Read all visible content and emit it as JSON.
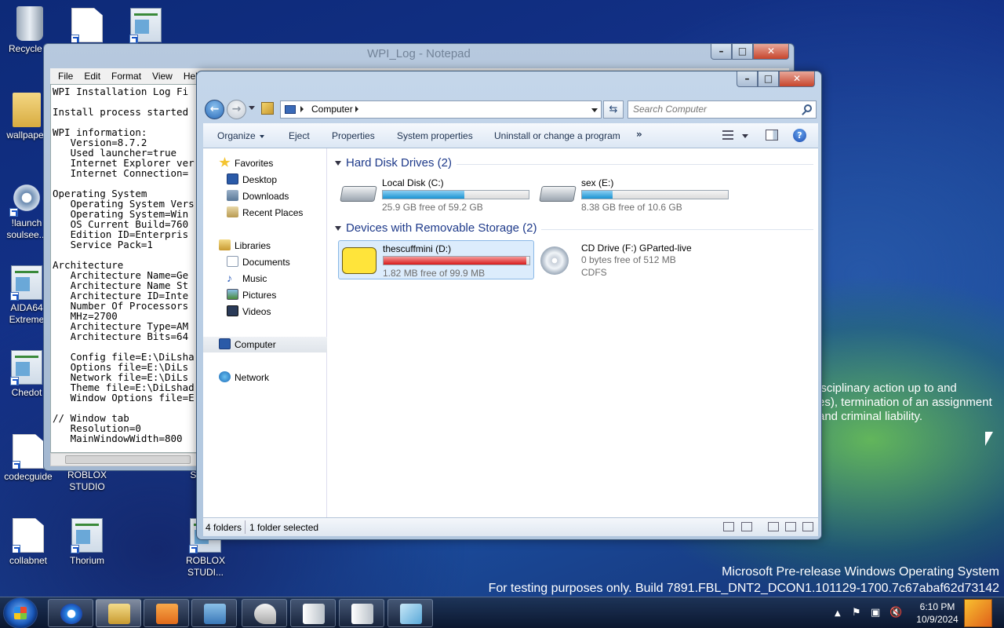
{
  "desktop": {
    "icons": [
      {
        "label": "Recycle Bin",
        "shown": "Recycle B"
      },
      {
        "label": "wallpaper",
        "shown": "wallpaper"
      },
      {
        "label": "!launch soulsee...",
        "line1": "!launch",
        "line2": "soulsee..."
      },
      {
        "label": "AIDA64 Extreme",
        "line1": "AIDA64",
        "line2": "Extreme"
      },
      {
        "label": "Chedot",
        "shown": "Chedot"
      },
      {
        "label": "codecguide",
        "shown": "codecguide"
      },
      {
        "label": "collabnet",
        "shown": "collabnet"
      },
      {
        "label": "ROBLOX STUDIO",
        "line1": "ROBLOX",
        "line2": "STUDIO"
      },
      {
        "label": "Thorium",
        "shown": "Thorium"
      },
      {
        "label": "ROBLOX STUDI...",
        "line1": "ROBLOX",
        "line2": "STUDI..."
      },
      {
        "label": "ST",
        "shown": "ST"
      }
    ]
  },
  "notepad": {
    "title": "WPI_Log - Notepad",
    "menu": [
      "File",
      "Edit",
      "Format",
      "View",
      "Help"
    ],
    "lines": [
      "WPI Installation Log Fi",
      "",
      "Install process started",
      "",
      "WPI information:",
      "   Version=8.7.2",
      "   Used launcher=true",
      "   Internet Explorer ver",
      "   Internet Connection=",
      "",
      "Operating System",
      "   Operating System Vers",
      "   Operating System=Win",
      "   OS Current Build=760",
      "   Edition ID=Enterpris",
      "   Service Pack=1",
      "",
      "Architecture",
      "   Architecture Name=Ge",
      "   Architecture Name St",
      "   Architecture ID=Inte",
      "   Number Of Processors",
      "   MHz=2700",
      "   Architecture Type=AM",
      "   Architecture Bits=64",
      "",
      "   Config file=E:\\DiLsha",
      "   Options file=E:\\DiLs",
      "   Network file=E:\\DiLs",
      "   Theme file=E:\\DiLshad",
      "   Window Options file=E",
      "",
      "// Window tab",
      "   Resolution=0",
      "   MainWindowWidth=800"
    ]
  },
  "explorer": {
    "address": "Computer",
    "search_placeholder": "Search Computer",
    "toolbar": {
      "organize": "Organize",
      "eject": "Eject",
      "properties": "Properties",
      "system_properties": "System properties",
      "uninstall": "Uninstall or change a program",
      "more": "»"
    },
    "nav": {
      "favorites": "Favorites",
      "desktop": "Desktop",
      "downloads": "Downloads",
      "recent_places": "Recent Places",
      "libraries": "Libraries",
      "documents": "Documents",
      "music": "Music",
      "pictures": "Pictures",
      "videos": "Videos",
      "computer": "Computer",
      "network": "Network"
    },
    "groups": {
      "hdd": "Hard Disk Drives (2)",
      "removable": "Devices with Removable Storage (2)"
    },
    "drives": [
      {
        "name": "Local Disk (C:)",
        "free": "25.9 GB free of 59.2 GB",
        "used_fraction": 0.56,
        "bar_color": "#1a94d2"
      },
      {
        "name": "sex (E:)",
        "free": "8.38 GB free of 10.6 GB",
        "used_fraction": 0.21,
        "bar_color": "#1a94d2"
      },
      {
        "name": "thescuffmini (D:)",
        "free": "1.82 MB free of 99.9 MB",
        "used_fraction": 0.98,
        "bar_color": "#d81a1a"
      },
      {
        "name": "CD Drive (F:) GParted-live",
        "free": "0 bytes free of 512 MB",
        "fs": "CDFS"
      }
    ],
    "status": {
      "count": "4 folders",
      "selected": "1 folder selected"
    }
  },
  "overlay": {
    "line1": "isciplinary action up to and",
    "line2": "es), termination of an assignment",
    "line3": "and criminal liability."
  },
  "watermark": {
    "line1": "Microsoft Pre-release Windows Operating System",
    "line2": "For testing purposes only. Build 7891.FBL_DNT2_DCON1.101129-1700.7c67abaf62d73142"
  },
  "taskbar": {
    "time": "6:10 PM",
    "date": "10/9/2024"
  }
}
